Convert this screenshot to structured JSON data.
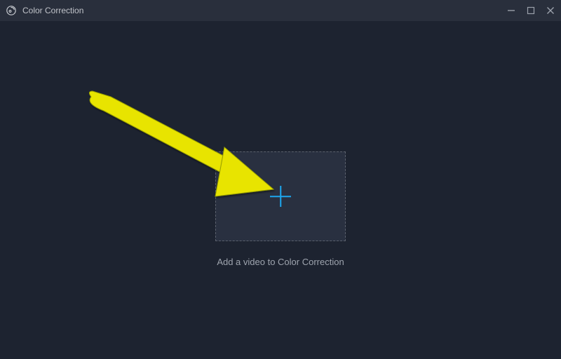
{
  "titlebar": {
    "title": "Color Correction"
  },
  "main": {
    "hint": "Add a video to Color Correction"
  },
  "icons": {
    "app": "app-circle-icon",
    "plus": "plus-icon",
    "minimize": "minimize-icon",
    "maximize": "maximize-icon",
    "close": "close-icon"
  },
  "colors": {
    "bg": "#1d2330",
    "titlebar": "#292f3c",
    "dropzone": "#293040",
    "accent": "#1da7ef",
    "arrow": "#e8e400"
  }
}
